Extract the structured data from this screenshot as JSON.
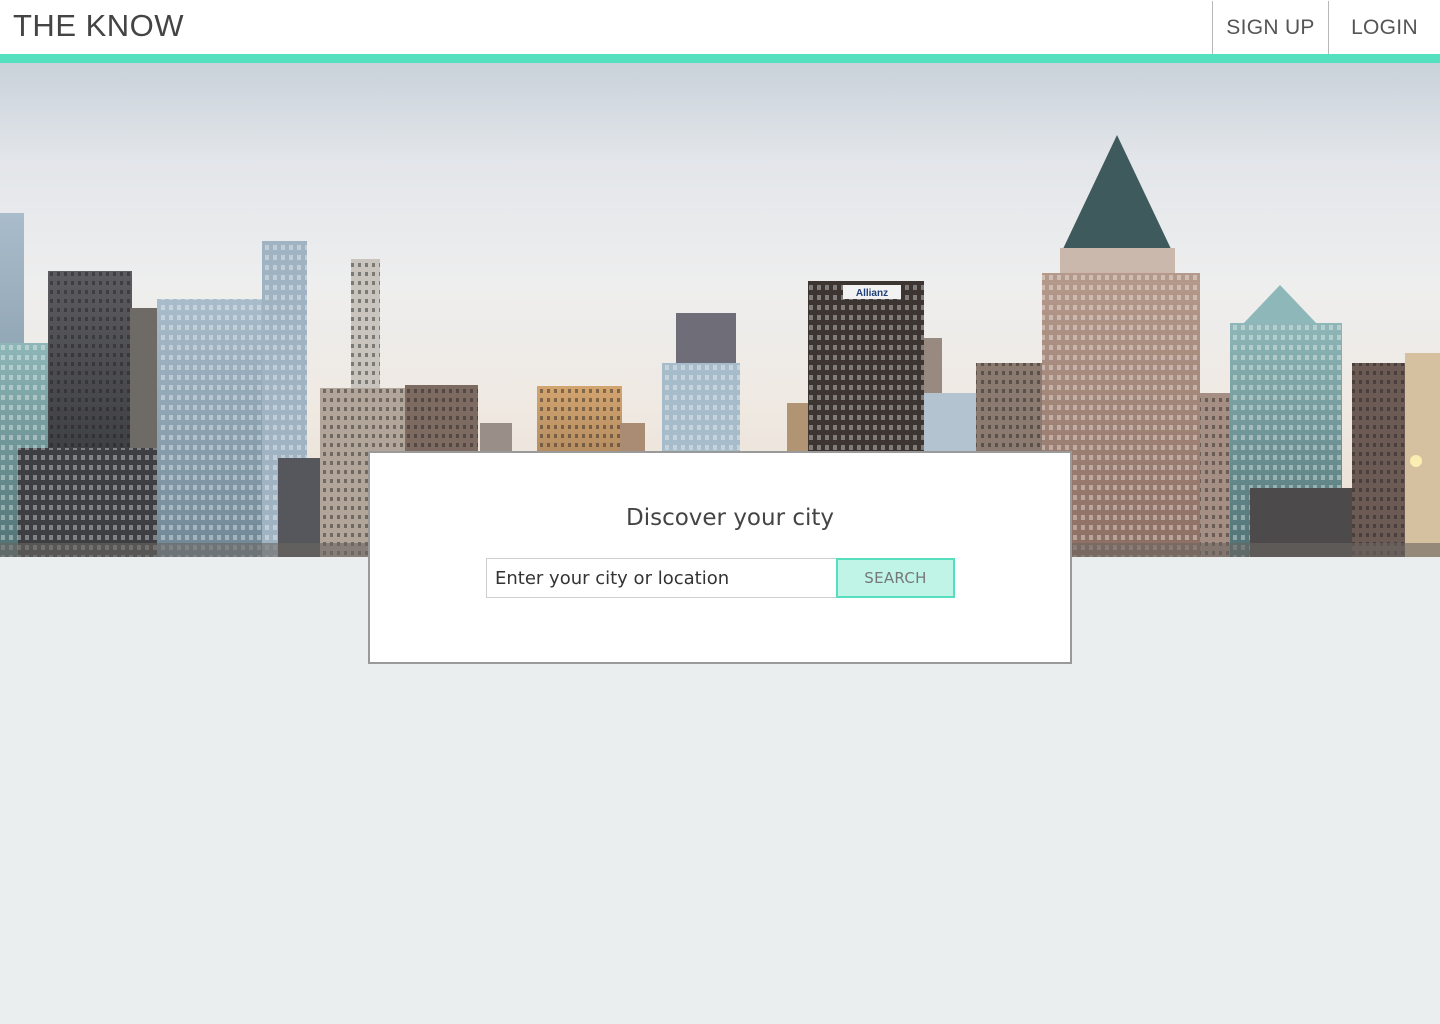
{
  "header": {
    "logo": "THE KNOW",
    "nav": [
      {
        "label": "SIGN UP"
      },
      {
        "label": "LOGIN"
      }
    ]
  },
  "colors": {
    "accent": "#55e0c0",
    "button_fill": "#bff4e6",
    "page_background": "#ebeeef"
  },
  "hero": {
    "image": "city-skyline-photo",
    "sign_text": "Allianz"
  },
  "search_card": {
    "title": "Discover your city",
    "input_placeholder": "Enter your city or location",
    "input_value": "",
    "button_label": "SEARCH"
  }
}
